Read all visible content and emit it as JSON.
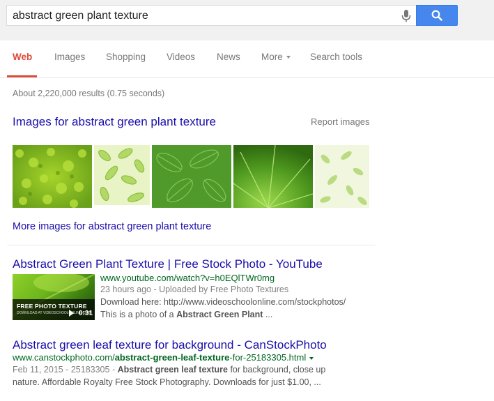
{
  "search": {
    "query": "abstract green plant texture"
  },
  "tabs": [
    {
      "label": "Web",
      "active": true
    },
    {
      "label": "Images"
    },
    {
      "label": "Shopping"
    },
    {
      "label": "Videos"
    },
    {
      "label": "News"
    },
    {
      "label": "More"
    },
    {
      "label": "Search tools"
    }
  ],
  "stats": "About 2,220,000 results (0.75 seconds)",
  "images_block": {
    "header": "Images for abstract green plant texture",
    "report": "Report images",
    "more": "More images for abstract green plant texture"
  },
  "results": [
    {
      "title": "Abstract Green Plant Texture | Free Stock Photo - YouTube",
      "url": "www.youtube.com/watch?v=h0EQlTWr0mg",
      "meta": "23 hours ago - Uploaded by Free Photo Textures",
      "snippet1": "Download here: http://www.videoschoolonline.com/stockphotos/",
      "snippet2_pre": "This is a photo of a ",
      "snippet2_bold": "Abstract Green Plant",
      "snippet2_post": " ...",
      "video": {
        "label": "FREE PHOTO TEXTURE",
        "sublabel": "DOWNLOAD AT VIDEOSCHOOLONLINE.COM",
        "duration": "0:31"
      }
    },
    {
      "title": "Abstract green leaf texture for background - CanStockPhoto",
      "url_pre": "www.canstockphoto.com/",
      "url_bold": "abstract-green-leaf-texture",
      "url_post": "-for-25183305.html",
      "meta": "Feb 11, 2015 - 25183305 - ",
      "snippet_bold": "Abstract green leaf texture",
      "snippet_rest": " for background, close up",
      "snippet2": "nature. Affordable Royalty Free Stock Photography. Downloads for just $1.00, ..."
    }
  ]
}
